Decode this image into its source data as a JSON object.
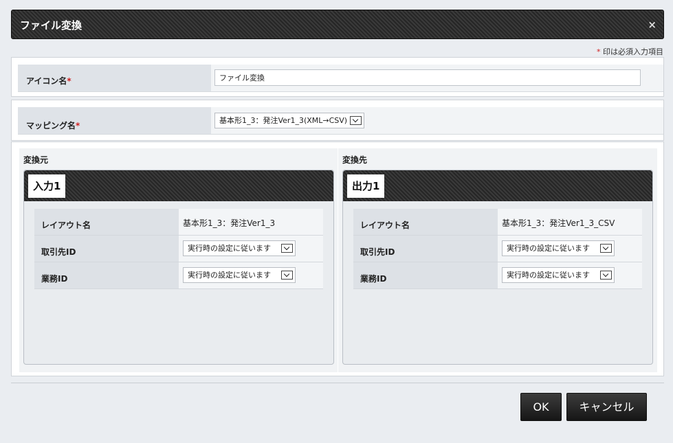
{
  "dialog": {
    "title": "ファイル変換",
    "close_glyph": "×"
  },
  "required_note": {
    "mark": "*",
    "text": "印は必須入力項目"
  },
  "icon_name": {
    "label": "アイコン名",
    "value": "ファイル変換"
  },
  "mapping_name": {
    "label": "マッピング名",
    "value": "基本形1_3：発注Ver1_3(XML→CSV)"
  },
  "source": {
    "title": "変換元",
    "tab": "入力1",
    "rows": [
      {
        "label": "レイアウト名",
        "value": "基本形1_3：発注Ver1_3"
      },
      {
        "label": "取引先ID",
        "value": "実行時の設定に従います"
      },
      {
        "label": "業務ID",
        "value": "実行時の設定に従います"
      }
    ]
  },
  "target": {
    "title": "変換先",
    "tab": "出力1",
    "rows": [
      {
        "label": "レイアウト名",
        "value": "基本形1_3：発注Ver1_3_CSV"
      },
      {
        "label": "取引先ID",
        "value": "実行時の設定に従います"
      },
      {
        "label": "業務ID",
        "value": "実行時の設定に従います"
      }
    ]
  },
  "buttons": {
    "ok": "OK",
    "cancel": "キャンセル"
  }
}
